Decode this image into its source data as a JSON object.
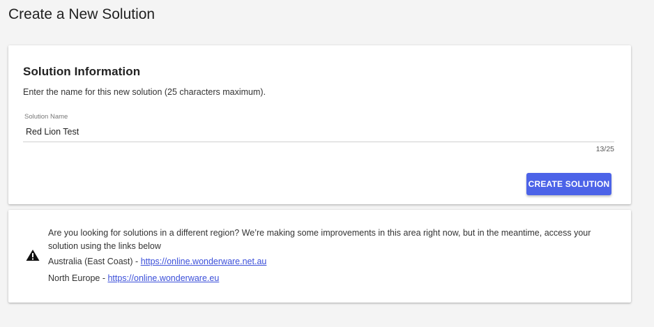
{
  "page": {
    "title": "Create a New Solution"
  },
  "solution_info": {
    "title": "Solution Information",
    "description": "Enter the name for this new solution (25 characters maximum).",
    "name_field": {
      "label": "Solution Name",
      "value": "Red Lion Test",
      "counter": "13/25"
    },
    "create_button_label": "CREATE SOLUTION",
    "create_button_color": "#4c63e8"
  },
  "region_notice": {
    "icon": "warning-icon",
    "message": "Are you looking for solutions in a different region? We’re making some improvements in this area right now, but in the meantime, access your solution using the links below",
    "links": [
      {
        "region": "Australia (East Coast) - ",
        "url_text": "https://online.wonderware.net.au"
      },
      {
        "region": "North Europe - ",
        "url_text": "https://online.wonderware.eu"
      }
    ],
    "link_color": "#3b4fd9"
  }
}
